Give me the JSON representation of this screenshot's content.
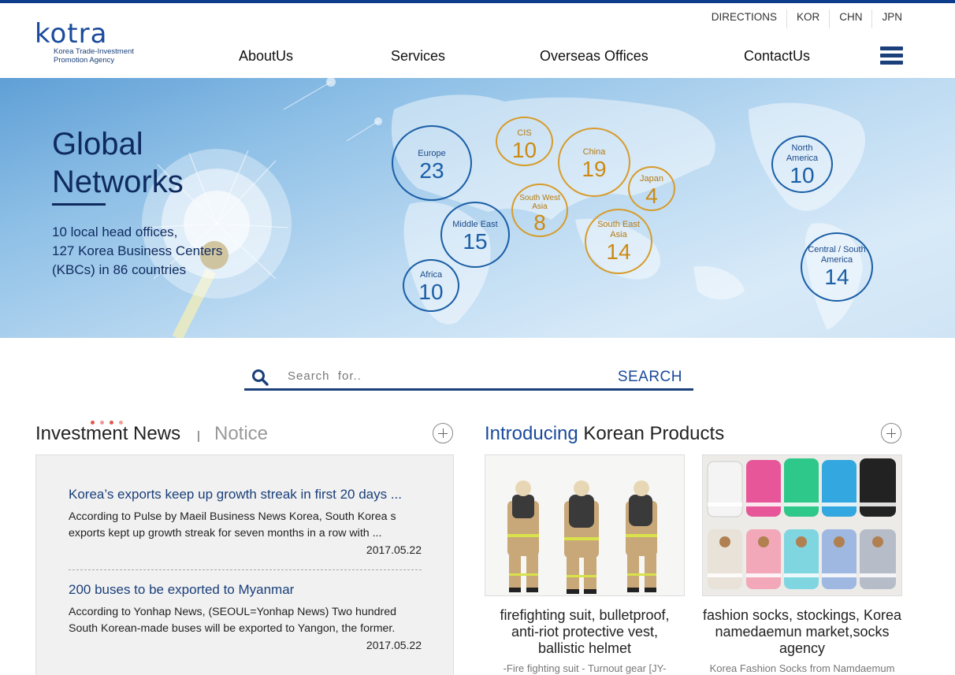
{
  "header": {
    "logo": "kotra",
    "logo_sub_line1": "Korea Trade-Investment",
    "logo_sub_line2": "Promotion Agency",
    "util_links": [
      "DIRECTIONS",
      "KOR",
      "CHN",
      "JPN"
    ],
    "nav": [
      "AboutUs",
      "Services",
      "Overseas Offices",
      "ContactUs"
    ],
    "menu_icon": "hamburger-menu-icon"
  },
  "hero": {
    "title_line1": "Global",
    "title_line2": "Networks",
    "desc_line1": "10 local head offices,",
    "desc_line2": "127 Korea Business Centers",
    "desc_line3": "(KBCs) in 86 countries",
    "regions": [
      {
        "name": "Europe",
        "count": "23"
      },
      {
        "name": "CIS",
        "count": "10"
      },
      {
        "name": "China",
        "count": "19"
      },
      {
        "name": "Japan",
        "count": "4"
      },
      {
        "name": "South West Asia",
        "count": "8"
      },
      {
        "name": "Middle East",
        "count": "15"
      },
      {
        "name": "South East Asia",
        "count": "14"
      },
      {
        "name": "Africa",
        "count": "10"
      },
      {
        "name": "North America",
        "count": "10"
      },
      {
        "name": "Central / South America",
        "count": "14"
      }
    ],
    "colors": {
      "blue": "#1a5ea6",
      "gold": "#d79b2a"
    }
  },
  "search": {
    "placeholder": "Search  for..",
    "button": "SEARCH"
  },
  "news": {
    "title": "Investment News",
    "separator": "|",
    "notice_tab": "Notice",
    "items": [
      {
        "title": "Korea’s exports keep up growth streak in first 20 days ...",
        "desc_line1": "According to Pulse by Maeil Business News Korea, South Korea s",
        "desc_line2": "exports kept up growth streak for seven months in a row with ...",
        "date": "2017.05.22"
      },
      {
        "title": "200 buses to be exported to Myanmar",
        "desc_line1": "According to Yonhap News, (SEOUL=Yonhap News) Two hundred",
        "desc_line2": "South Korean-made buses will be exported to Yangon, the former.",
        "date": "2017.05.22"
      }
    ]
  },
  "products": {
    "title_highlight": "Introducing",
    "title_rest": " Korean Products",
    "items": [
      {
        "caption_line1": "firefighting suit, bulletproof,",
        "caption_line2": "anti-riot protective vest,",
        "caption_line3": "ballistic helmet",
        "sub": "-Fire fighting suit - Turnout gear [JY-"
      },
      {
        "caption_line1": "fashion socks, stockings, Korea",
        "caption_line2": "namedaemun market,socks",
        "caption_line3": "agency",
        "sub": "Korea Fashion Socks from Namdaemum"
      }
    ]
  }
}
